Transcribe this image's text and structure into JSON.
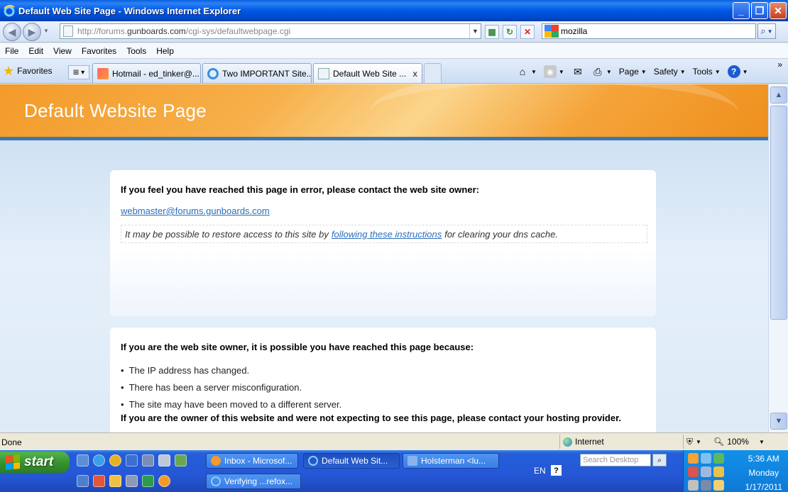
{
  "window": {
    "title": "Default Web Site Page - Windows Internet Explorer"
  },
  "address": {
    "url_prefix": "http://forums.",
    "url_host": "gunboards.com",
    "url_path": "/cgi-sys/defaultwebpage.cgi"
  },
  "search": {
    "value": "mozilla"
  },
  "menu": {
    "items": [
      "File",
      "Edit",
      "View",
      "Favorites",
      "Tools",
      "Help"
    ]
  },
  "favorites_label": "Favorites",
  "tabs": [
    {
      "label": "Hotmail - ed_tinker@..."
    },
    {
      "label": "Two IMPORTANT Site..."
    },
    {
      "label": "Default Web Site ...",
      "close": "x"
    }
  ],
  "command_bar": {
    "page": "Page",
    "safety": "Safety",
    "tools": "Tools",
    "chevron": "»"
  },
  "page": {
    "banner_title": "Default Website Page",
    "card1": {
      "heading": "If you feel you have reached this page in error, please contact the web site owner:",
      "email": "webmaster@forums.gunboards.com",
      "dns_before": "It may be possible to restore access to this site by",
      "dns_link": "following these instructions",
      "dns_after": "for clearing your dns cache."
    },
    "card2": {
      "heading": "If you are the web site owner, it is possible you have reached this page because:",
      "reasons": [
        "The IP address has changed.",
        "There has been a server misconfiguration.",
        "The site may have been moved to a different server."
      ],
      "footer": "If you are the owner of this website and were not expecting to see this page, please contact your hosting provider."
    }
  },
  "status": {
    "left": "Done",
    "zone": "Internet",
    "zoom": "100%"
  },
  "taskbar": {
    "start": "start",
    "buttons": [
      {
        "label": "Inbox - Microsof..."
      },
      {
        "label": "Default Web Sit..."
      },
      {
        "label": "Holsterman <lu..."
      },
      {
        "label": "Verifying ...refox..."
      }
    ],
    "lang": "EN",
    "help": "?",
    "search_placeholder": "Search Desktop",
    "time": "5:36 AM",
    "day": "Monday",
    "date": "1/17/2011"
  }
}
